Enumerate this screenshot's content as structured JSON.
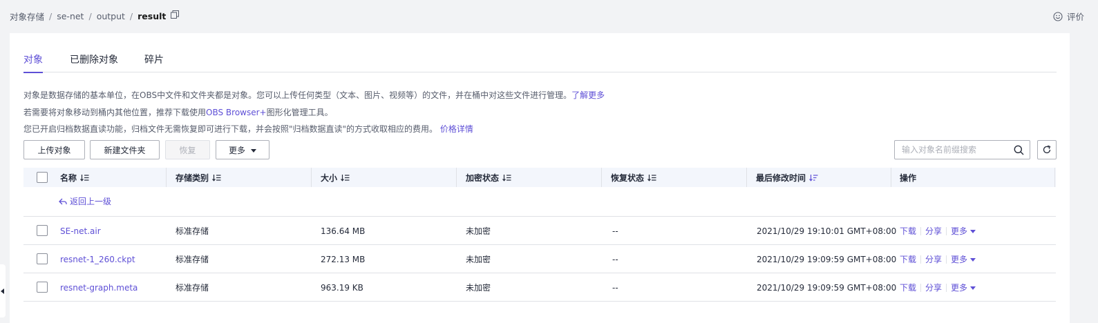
{
  "breadcrumb": {
    "items": [
      "对象存储",
      "se-net",
      "output"
    ],
    "current": "result",
    "separator": "/"
  },
  "feedback": {
    "label": "评价"
  },
  "tabs": [
    {
      "label": "对象",
      "active": true
    },
    {
      "label": "已删除对象",
      "active": false
    },
    {
      "label": "碎片",
      "active": false
    }
  ],
  "info": {
    "line1_text": "对象是数据存储的基本单位，在OBS中文件和文件夹都是对象。您可以上传任何类型（文本、图片、视频等）的文件，并在桶中对这些文件进行管理。",
    "line1_link": "了解更多",
    "line2_prefix": "若需要将对象移动到桶内其他位置，推荐下载使用",
    "line2_link": "OBS Browser+",
    "line2_suffix": "图形化管理工具。",
    "line3_text": "您已开启归档数据直读功能，归档文件无需恢复即可进行下载，并会按照\"归档数据直读\"的方式收取相应的费用。",
    "line3_link": "价格详情"
  },
  "toolbar": {
    "upload": "上传对象",
    "new_folder": "新建文件夹",
    "restore": "恢复",
    "more": "更多"
  },
  "search": {
    "placeholder": "输入对象名前缀搜索"
  },
  "table": {
    "headers": {
      "name": "名称",
      "storage": "存储类别",
      "size": "大小",
      "encryption": "加密状态",
      "restore": "恢复状态",
      "modified": "最后修改时间",
      "ops": "操作"
    },
    "back_label": "返回上一级",
    "rows": [
      {
        "name": "SE-net.air",
        "storage": "标准存储",
        "size": "136.64 MB",
        "encryption": "未加密",
        "restore": "--",
        "modified": "2021/10/29 19:10:01 GMT+08:00"
      },
      {
        "name": "resnet-1_260.ckpt",
        "storage": "标准存储",
        "size": "272.13 MB",
        "encryption": "未加密",
        "restore": "--",
        "modified": "2021/10/29 19:09:59 GMT+08:00"
      },
      {
        "name": "resnet-graph.meta",
        "storage": "标准存储",
        "size": "963.19 KB",
        "encryption": "未加密",
        "restore": "--",
        "modified": "2021/10/29 19:09:59 GMT+08:00"
      }
    ],
    "ops": {
      "download": "下载",
      "share": "分享",
      "more": "更多"
    }
  },
  "colors": {
    "accent": "#5e4fd6",
    "text": "#252b3a",
    "muted": "#575d6c",
    "border": "#dfe1e6",
    "header_bg": "#f3f6fc"
  }
}
